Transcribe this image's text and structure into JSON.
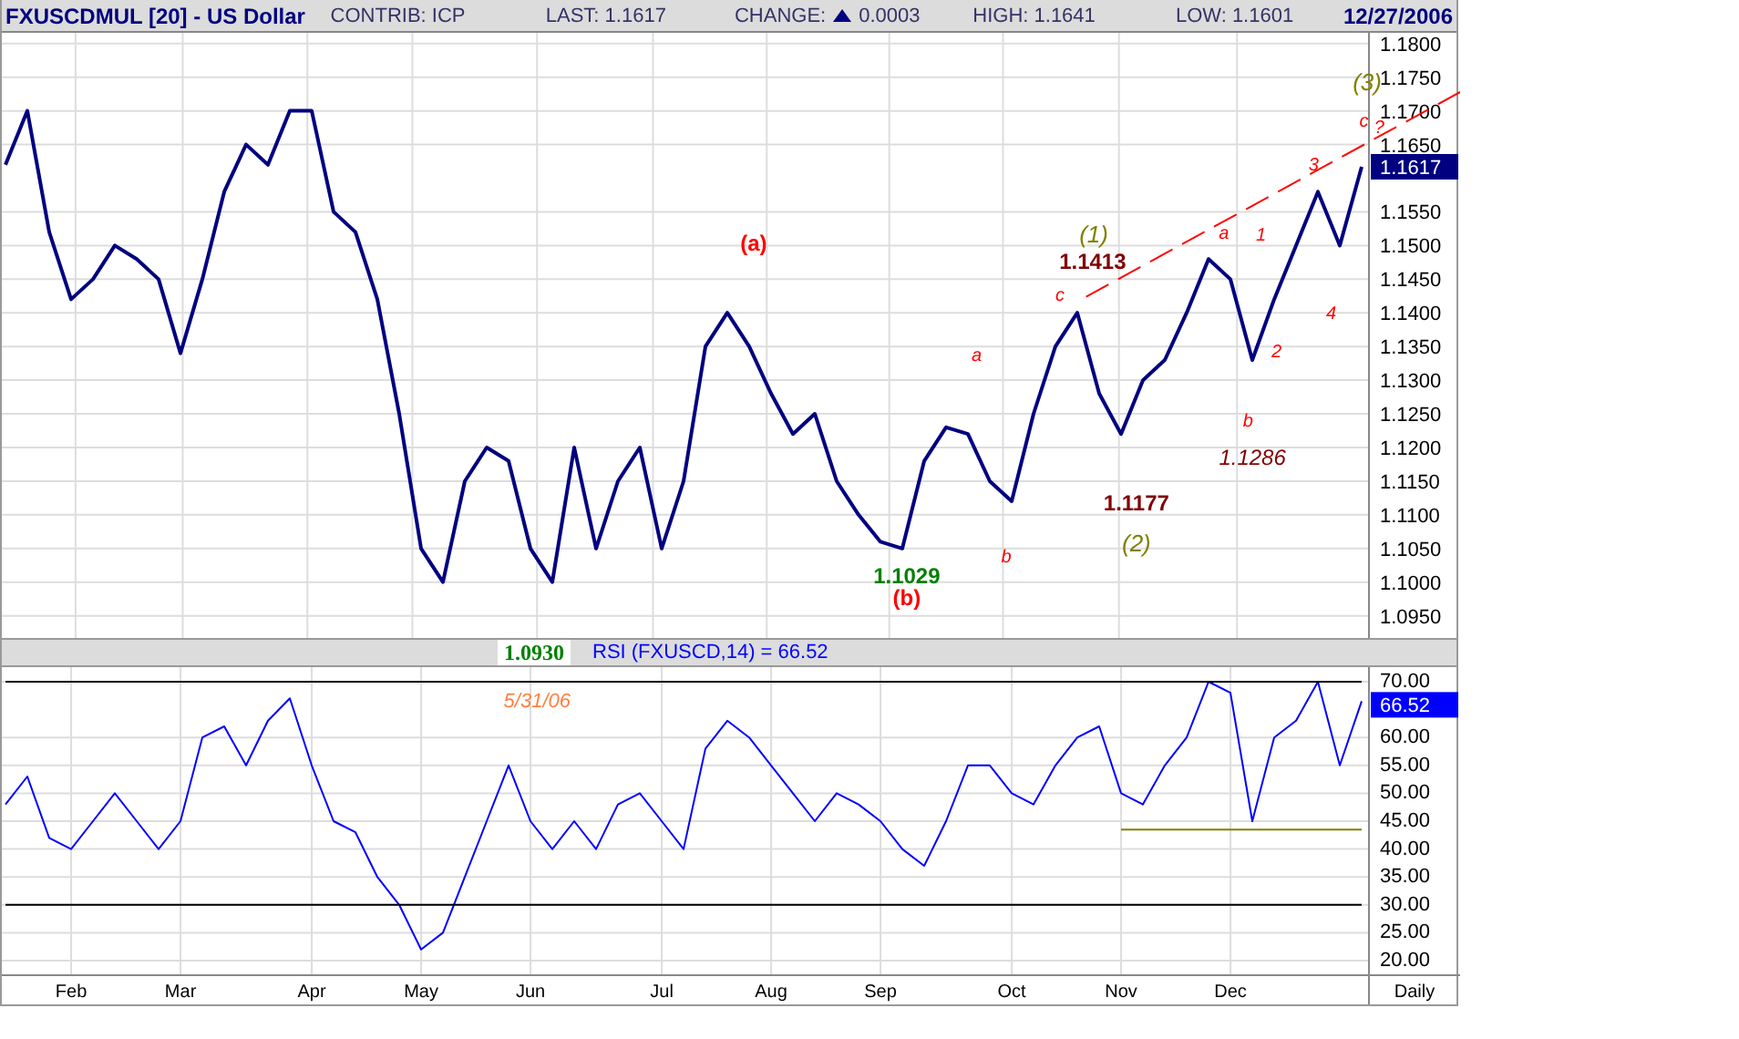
{
  "header": {
    "symbol": "FXUSCDMUL [20] - US Dollar",
    "contrib": "CONTRIB: ICP",
    "last": "LAST: 1.1617",
    "change_label": "CHANGE:",
    "change": "0.0003",
    "high": "HIGH: 1.1641",
    "low": "LOW: 1.1601",
    "date": "12/27/2006"
  },
  "price_chart": {
    "last_label": "1.1617",
    "chart_data": {
      "type": "line",
      "series": [
        {
          "color": "#000080",
          "values": [
            1.162,
            1.17,
            1.152,
            1.142,
            1.145,
            1.15,
            1.148,
            1.145,
            1.134,
            1.145,
            1.158,
            1.165,
            1.162,
            1.17,
            1.17,
            1.155,
            1.152,
            1.142,
            1.125,
            1.105,
            1.1,
            1.115,
            1.12,
            1.118,
            1.105,
            1.1,
            1.12,
            1.105,
            1.115,
            1.12,
            1.105,
            1.115,
            1.135,
            1.14,
            1.135,
            1.128,
            1.122,
            1.125,
            1.115,
            1.11,
            1.106,
            1.105,
            1.118,
            1.123,
            1.122,
            1.115,
            1.112,
            1.125,
            1.135,
            1.14,
            1.128,
            1.122,
            1.13,
            1.133,
            1.14,
            1.148,
            1.145,
            1.133,
            1.142,
            1.15,
            1.158,
            1.15,
            1.1617
          ]
        }
      ],
      "ylim": [
        1.0917,
        1.1816
      ],
      "grid": true,
      "yticks": [
        {
          "value": 1.18,
          "label": "1.1800"
        },
        {
          "value": 1.175,
          "label": "1.1750"
        },
        {
          "value": 1.17,
          "label": "1.1700"
        },
        {
          "value": 1.165,
          "label": "1.1650"
        },
        {
          "value": 1.155,
          "label": "1.1550"
        },
        {
          "value": 1.15,
          "label": "1.1500"
        },
        {
          "value": 1.145,
          "label": "1.1450"
        },
        {
          "value": 1.14,
          "label": "1.1400"
        },
        {
          "value": 1.135,
          "label": "1.1350"
        },
        {
          "value": 1.13,
          "label": "1.1300"
        },
        {
          "value": 1.125,
          "label": "1.1250"
        },
        {
          "value": 1.12,
          "label": "1.1200"
        },
        {
          "value": 1.115,
          "label": "1.1150"
        },
        {
          "value": 1.11,
          "label": "1.1100"
        },
        {
          "value": 1.105,
          "label": "1.1050"
        },
        {
          "value": 1.1,
          "label": "1.1000"
        },
        {
          "value": 1.095,
          "label": "1.0950"
        }
      ],
      "annotations": [
        "(3)",
        "c",
        "?",
        "3",
        "a",
        "(1)",
        "1",
        "(a)",
        "1.1413",
        "c",
        "4",
        "2",
        "a",
        "b",
        "1.1286",
        "1.1177",
        "(2)",
        "b",
        "1.1029",
        "(b)"
      ]
    },
    "annotation_styles": [
      {
        "kind": "degree",
        "color": "#808000"
      },
      {
        "kind": "minor",
        "color": "#ff0000"
      },
      {
        "kind": "minor",
        "color": "#ff0000"
      },
      {
        "kind": "minor",
        "color": "#ff0000"
      },
      {
        "kind": "minor",
        "color": "#ff0000"
      },
      {
        "kind": "degree",
        "color": "#808000"
      },
      {
        "kind": "minor",
        "color": "#ff0000"
      },
      {
        "kind": "wave",
        "color": "#ff0000"
      },
      {
        "kind": "price",
        "color": "#800000"
      },
      {
        "kind": "minor",
        "color": "#ff0000"
      },
      {
        "kind": "minor",
        "color": "#ff0000"
      },
      {
        "kind": "minor",
        "color": "#ff0000"
      },
      {
        "kind": "minor",
        "color": "#ff0000"
      },
      {
        "kind": "minor",
        "color": "#ff0000"
      },
      {
        "kind": "price_italic",
        "color": "#800000"
      },
      {
        "kind": "price",
        "color": "#800000"
      },
      {
        "kind": "degree",
        "color": "#808000"
      },
      {
        "kind": "minor",
        "color": "#ff0000"
      },
      {
        "kind": "price",
        "color": "#008000"
      },
      {
        "kind": "wave",
        "color": "#ff0000"
      }
    ]
  },
  "low_marker": {
    "price": "1.0930",
    "date": "5/31/06"
  },
  "rsi_title": "RSI (FXUSCD,14) = 66.52",
  "rsi_chart": {
    "last_label": "66.52",
    "chart_data": {
      "type": "line",
      "categories": [
        null,
        null,
        null,
        "Feb",
        null,
        null,
        null,
        null,
        "Mar",
        null,
        null,
        null,
        null,
        null,
        "Apr",
        null,
        null,
        null,
        null,
        "May",
        null,
        null,
        null,
        null,
        "Jun",
        null,
        null,
        null,
        null,
        null,
        "Jul",
        null,
        null,
        null,
        null,
        "Aug",
        null,
        null,
        null,
        null,
        "Sep",
        null,
        null,
        null,
        null,
        null,
        "Oct",
        null,
        null,
        null,
        null,
        "Nov",
        null,
        null,
        null,
        null,
        "Dec",
        null,
        null,
        null,
        null,
        null,
        null
      ],
      "series": [
        {
          "color": "#0000ff",
          "values": [
            48,
            53,
            42,
            40,
            45,
            50,
            45,
            40,
            45,
            60,
            62,
            55,
            63,
            67,
            55,
            45,
            43,
            35,
            30,
            22,
            25,
            35,
            45,
            55,
            45,
            40,
            45,
            40,
            48,
            50,
            45,
            40,
            58,
            63,
            60,
            55,
            50,
            45,
            50,
            48,
            45,
            40,
            37,
            45,
            55,
            55,
            50,
            48,
            55,
            60,
            62,
            50,
            48,
            55,
            60,
            70,
            68,
            45,
            60,
            63,
            70,
            55,
            66.5
          ]
        },
        {
          "color": "#000000",
          "values": [
            70,
            70,
            70,
            70,
            70,
            70,
            70,
            70,
            70,
            70,
            70,
            70,
            70,
            70,
            70,
            70,
            70,
            70,
            70,
            70,
            70,
            70,
            70,
            70,
            70,
            70,
            70,
            70,
            70,
            70,
            70,
            70,
            70,
            70,
            70,
            70,
            70,
            70,
            70,
            70,
            70,
            70,
            70,
            70,
            70,
            70,
            70,
            70,
            70,
            70,
            70,
            70,
            70,
            70,
            70,
            70,
            70,
            70,
            70,
            70,
            70,
            70,
            70
          ]
        },
        {
          "color": "#000000",
          "values": [
            30,
            30,
            30,
            30,
            30,
            30,
            30,
            30,
            30,
            30,
            30,
            30,
            30,
            30,
            30,
            30,
            30,
            30,
            30,
            30,
            30,
            30,
            30,
            30,
            30,
            30,
            30,
            30,
            30,
            30,
            30,
            30,
            30,
            30,
            30,
            30,
            30,
            30,
            30,
            30,
            30,
            30,
            30,
            30,
            30,
            30,
            30,
            30,
            30,
            30,
            30,
            30,
            30,
            30,
            30,
            30,
            30,
            30,
            30,
            30,
            30,
            30,
            30
          ]
        },
        {
          "color": "#808000",
          "values": [
            null,
            null,
            null,
            null,
            null,
            null,
            null,
            null,
            null,
            null,
            null,
            null,
            null,
            null,
            null,
            null,
            null,
            null,
            null,
            null,
            null,
            null,
            null,
            null,
            null,
            null,
            null,
            null,
            null,
            null,
            null,
            null,
            null,
            null,
            null,
            null,
            null,
            null,
            null,
            null,
            null,
            null,
            null,
            null,
            null,
            null,
            null,
            null,
            null,
            null,
            null,
            43.5,
            43.5,
            43.5,
            43.5,
            43.5,
            43.5,
            43.5,
            43.5,
            43.5,
            43.5,
            43.5,
            43.5
          ]
        }
      ],
      "ylim": [
        17.4,
        72.6
      ],
      "grid": true,
      "yticks": [
        {
          "value": 70,
          "label": "70.00"
        },
        {
          "value": 60,
          "label": "60.00"
        },
        {
          "value": 55,
          "label": "55.00"
        },
        {
          "value": 50,
          "label": "50.00"
        },
        {
          "value": 45,
          "label": "45.00"
        },
        {
          "value": 40,
          "label": "40.00"
        },
        {
          "value": 35,
          "label": "35.00"
        },
        {
          "value": 30,
          "label": "30.00"
        },
        {
          "value": 25,
          "label": "25.00"
        },
        {
          "value": 20,
          "label": "20.00"
        }
      ],
      "relative": false
    }
  },
  "period": "Daily"
}
